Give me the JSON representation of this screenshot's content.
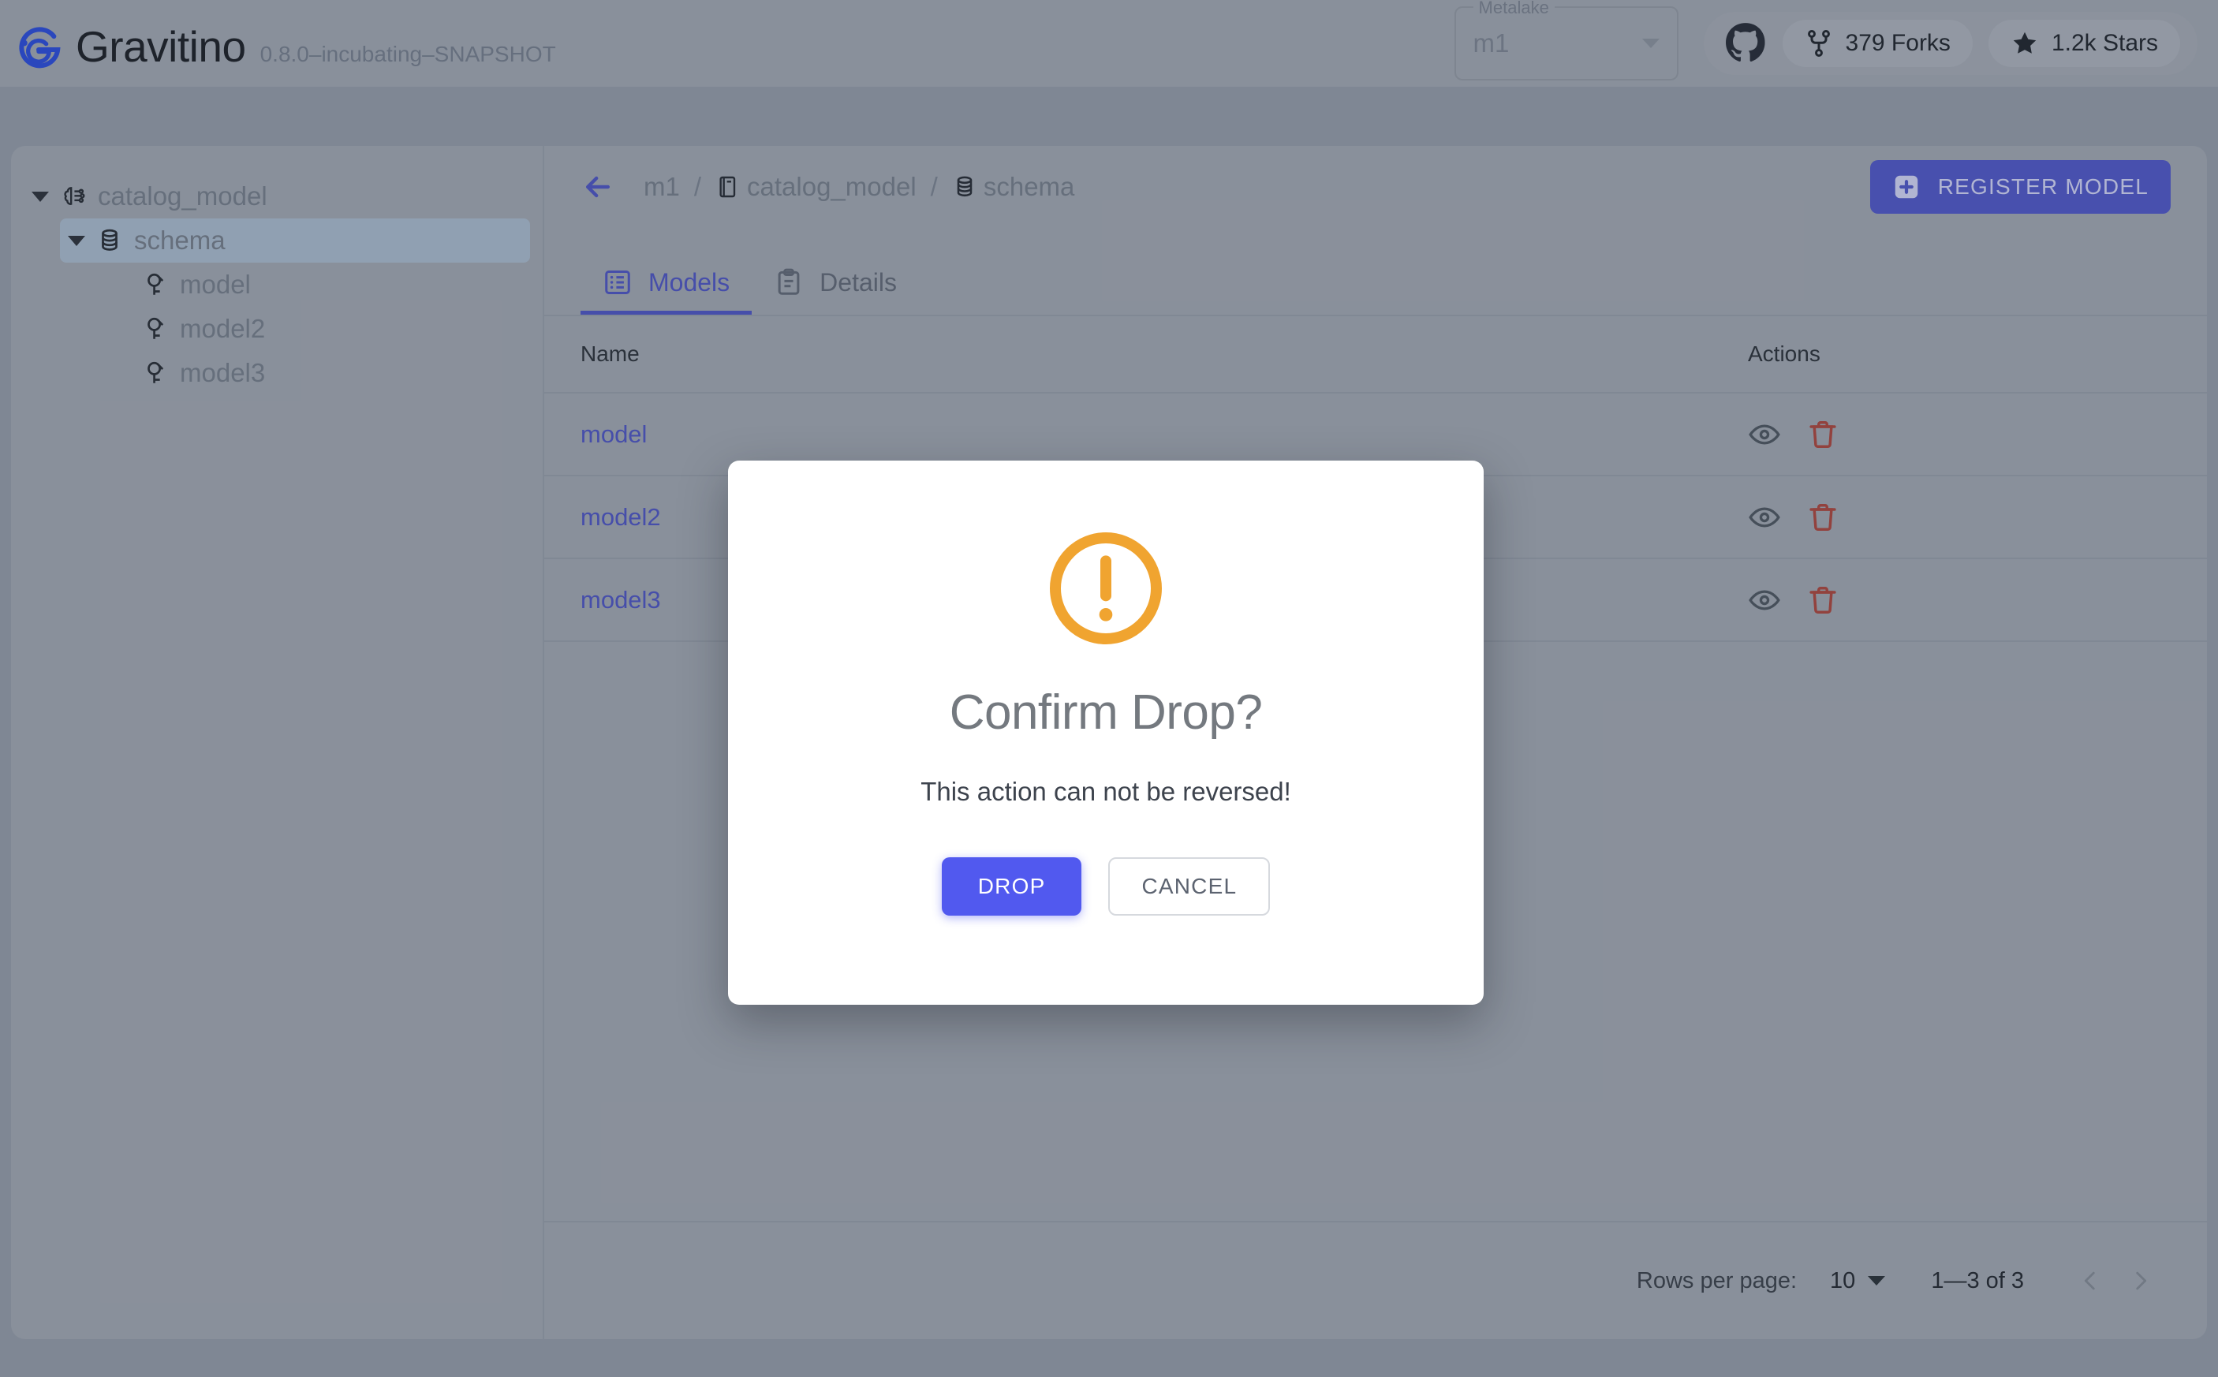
{
  "header": {
    "brand_name": "Gravitino",
    "version": "0.8.0–incubating–SNAPSHOT",
    "logo_icon": "gravitino-logo-icon",
    "metalake": {
      "label": "Metalake",
      "value": "m1",
      "caret_icon": "chevron-down-icon"
    },
    "github": {
      "mark_icon": "github-icon",
      "forks": {
        "icon": "fork-icon",
        "text": "379 Forks"
      },
      "stars": {
        "icon": "star-icon",
        "text": "1.2k Stars"
      }
    }
  },
  "sidebar": {
    "items": [
      {
        "label": "catalog_model",
        "icon": "model-catalog-icon",
        "level": 0,
        "expanded": true,
        "selected": false
      },
      {
        "label": "schema",
        "icon": "schema-icon",
        "level": 1,
        "expanded": true,
        "selected": true
      },
      {
        "label": "model",
        "icon": "model-icon",
        "level": 2,
        "expanded": null,
        "selected": false
      },
      {
        "label": "model2",
        "icon": "model-icon",
        "level": 2,
        "expanded": null,
        "selected": false
      },
      {
        "label": "model3",
        "icon": "model-icon",
        "level": 2,
        "expanded": null,
        "selected": false
      }
    ]
  },
  "breadcrumb": {
    "back_icon": "arrow-left-icon",
    "items": [
      {
        "label": "m1",
        "icon": null
      },
      {
        "label": "catalog_model",
        "icon": "catalog-icon"
      },
      {
        "label": "schema",
        "icon": "schema-icon"
      }
    ],
    "separator": "/"
  },
  "toolbar": {
    "register_label": "REGISTER MODEL",
    "register_icon": "plus-square-icon"
  },
  "tabs": [
    {
      "label": "Models",
      "icon": "list-icon",
      "active": true
    },
    {
      "label": "Details",
      "icon": "clipboard-icon",
      "active": false
    }
  ],
  "table": {
    "columns": [
      "Name",
      "Actions"
    ],
    "rows": [
      {
        "name": "model",
        "actions": [
          "eye-icon",
          "trash-icon"
        ]
      },
      {
        "name": "model2",
        "actions": [
          "eye-icon",
          "trash-icon"
        ]
      },
      {
        "name": "model3",
        "actions": [
          "eye-icon",
          "trash-icon"
        ]
      }
    ]
  },
  "pagination": {
    "rows_per_page_label": "Rows per page:",
    "rows_per_page_value": "10",
    "range_text": "1—3 of 3",
    "prev_icon": "chevron-left-icon",
    "next_icon": "chevron-right-icon"
  },
  "modal": {
    "icon": "warning-circle-icon",
    "title": "Confirm Drop?",
    "message": "This action can not be reversed!",
    "confirm_label": "DROP",
    "cancel_label": "CANCEL"
  },
  "colors": {
    "accent": "#4a52ba",
    "primary_button": "#5159ef",
    "warning": "#f0a430",
    "danger": "#a1453f",
    "page_bg": "#8b93a1",
    "card_bg": "#979ea9"
  }
}
